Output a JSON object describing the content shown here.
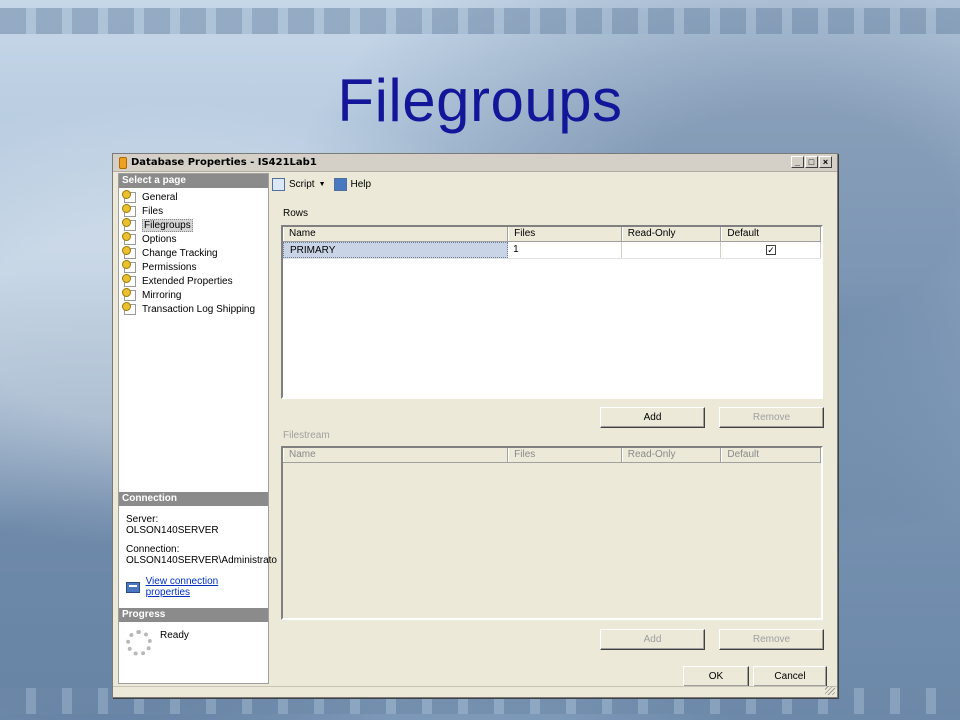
{
  "slide": {
    "title": "Filegroups"
  },
  "window": {
    "title": "Database Properties - IS421Lab1",
    "controls": {
      "minimize": "_",
      "maximize": "□",
      "close": "×"
    }
  },
  "select_page": {
    "header": "Select a page",
    "items": [
      {
        "label": "General",
        "icon": "page-icon"
      },
      {
        "label": "Files",
        "icon": "page-icon"
      },
      {
        "label": "Filegroups",
        "icon": "page-icon",
        "selected": true
      },
      {
        "label": "Options",
        "icon": "page-icon"
      },
      {
        "label": "Change Tracking",
        "icon": "page-icon"
      },
      {
        "label": "Permissions",
        "icon": "page-icon"
      },
      {
        "label": "Extended Properties",
        "icon": "page-icon"
      },
      {
        "label": "Mirroring",
        "icon": "page-icon"
      },
      {
        "label": "Transaction Log Shipping",
        "icon": "page-icon"
      }
    ]
  },
  "connection": {
    "header": "Connection",
    "server_label": "Server:",
    "server_value": "OLSON140SERVER",
    "connection_label": "Connection:",
    "connection_value": "OLSON140SERVER\\Administrato",
    "link_text": "View connection properties"
  },
  "progress": {
    "header": "Progress",
    "status": "Ready"
  },
  "toolbar": {
    "script_label": "Script",
    "help_label": "Help"
  },
  "rows_section": {
    "label": "Rows",
    "columns": [
      "Name",
      "Files",
      "Read-Only",
      "Default"
    ],
    "rows": [
      {
        "name": "PRIMARY",
        "files": "1",
        "read_only": false,
        "default": true
      }
    ],
    "add_button": "Add",
    "remove_button": "Remove"
  },
  "filestream_section": {
    "label": "Filestream",
    "columns": [
      "Name",
      "Files",
      "Read-Only",
      "Default"
    ],
    "add_button": "Add",
    "remove_button": "Remove"
  },
  "footer": {
    "ok_button": "OK",
    "cancel_button": "Cancel"
  }
}
